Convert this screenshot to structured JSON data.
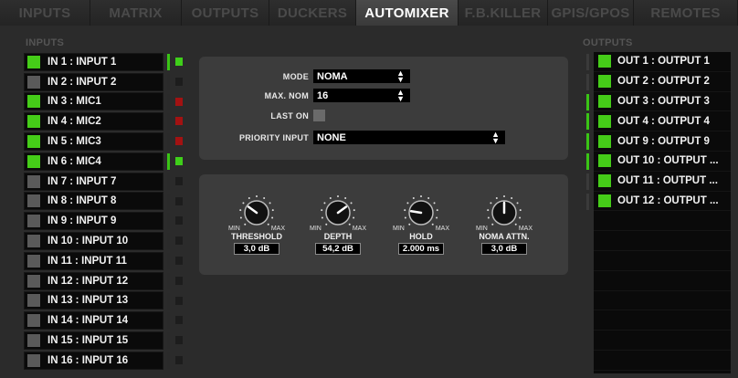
{
  "tabs": [
    {
      "label": "INPUTS",
      "active": false
    },
    {
      "label": "MATRIX",
      "active": false
    },
    {
      "label": "OUTPUTS",
      "active": false
    },
    {
      "label": "DUCKERS",
      "active": false
    },
    {
      "label": "AUTOMIXER",
      "active": true
    },
    {
      "label": "F.B.KILLER",
      "active": false
    },
    {
      "label": "GPIs/GPOs",
      "active": false
    },
    {
      "label": "REMOTES",
      "active": false
    }
  ],
  "inputs_label": "INPUTS",
  "outputs_label": "OUTPUTS",
  "inputs": [
    {
      "label": "IN 1 : INPUT 1",
      "enabled": true,
      "led": "green",
      "meter": true
    },
    {
      "label": "IN 2 : INPUT 2",
      "enabled": false,
      "led": "off",
      "meter": false
    },
    {
      "label": "IN 3 : MIC1",
      "enabled": true,
      "led": "red",
      "meter": false
    },
    {
      "label": "IN 4 : MIC2",
      "enabled": true,
      "led": "red",
      "meter": false
    },
    {
      "label": "IN 5 : MIC3",
      "enabled": true,
      "led": "red",
      "meter": false
    },
    {
      "label": "IN 6 : MIC4",
      "enabled": true,
      "led": "green",
      "meter": true
    },
    {
      "label": "IN 7 : INPUT 7",
      "enabled": false,
      "led": "off",
      "meter": false
    },
    {
      "label": "IN 8 : INPUT 8",
      "enabled": false,
      "led": "off",
      "meter": false
    },
    {
      "label": "IN 9 : INPUT 9",
      "enabled": false,
      "led": "off",
      "meter": false
    },
    {
      "label": "IN 10 : INPUT 10",
      "enabled": false,
      "led": "off",
      "meter": false
    },
    {
      "label": "IN 11 : INPUT 11",
      "enabled": false,
      "led": "off",
      "meter": false
    },
    {
      "label": "IN 12 : INPUT 12",
      "enabled": false,
      "led": "off",
      "meter": false
    },
    {
      "label": "IN 13 : INPUT 13",
      "enabled": false,
      "led": "off",
      "meter": false
    },
    {
      "label": "IN 14 : INPUT 14",
      "enabled": false,
      "led": "off",
      "meter": false
    },
    {
      "label": "IN 15 : INPUT 15",
      "enabled": false,
      "led": "off",
      "meter": false
    },
    {
      "label": "IN 16 : INPUT 16",
      "enabled": false,
      "led": "off",
      "meter": false
    }
  ],
  "settings": {
    "mode_label": "MODE",
    "mode_value": "NOMA",
    "max_nom_label": "MAX. NOM",
    "max_nom_value": "16",
    "last_on_label": "LAST ON",
    "priority_label": "PRIORITY INPUT",
    "priority_value": "NONE"
  },
  "knobs": [
    {
      "name": "THRESHOLD",
      "value": "3,0 dB",
      "level": 0.3
    },
    {
      "name": "DEPTH",
      "value": "54,2 dB",
      "level": 0.7
    },
    {
      "name": "HOLD",
      "value": "2.000 ms",
      "level": 0.2
    },
    {
      "name": "NOMA ATTN.",
      "value": "3,0 dB",
      "level": 0.5
    }
  ],
  "knob_min": "MIN",
  "knob_max": "MAX",
  "outputs": [
    {
      "label": "OUT 1 : OUTPUT 1",
      "meter": false
    },
    {
      "label": "OUT 2 : OUTPUT 2",
      "meter": false
    },
    {
      "label": "OUT 3 : OUTPUT 3",
      "meter": true
    },
    {
      "label": "OUT 4 : OUTPUT 4",
      "meter": true
    },
    {
      "label": "OUT 9 : OUTPUT 9",
      "meter": true
    },
    {
      "label": "OUT 10 : OUTPUT ...",
      "meter": true
    },
    {
      "label": "OUT 11 : OUTPUT ...",
      "meter": false
    },
    {
      "label": "OUT 12 : OUTPUT ...",
      "meter": false
    }
  ],
  "colors": {
    "active_green": "#45cc18",
    "led_red": "#a31212",
    "panel": "#3c3c3c",
    "background": "#2b2b2b"
  }
}
